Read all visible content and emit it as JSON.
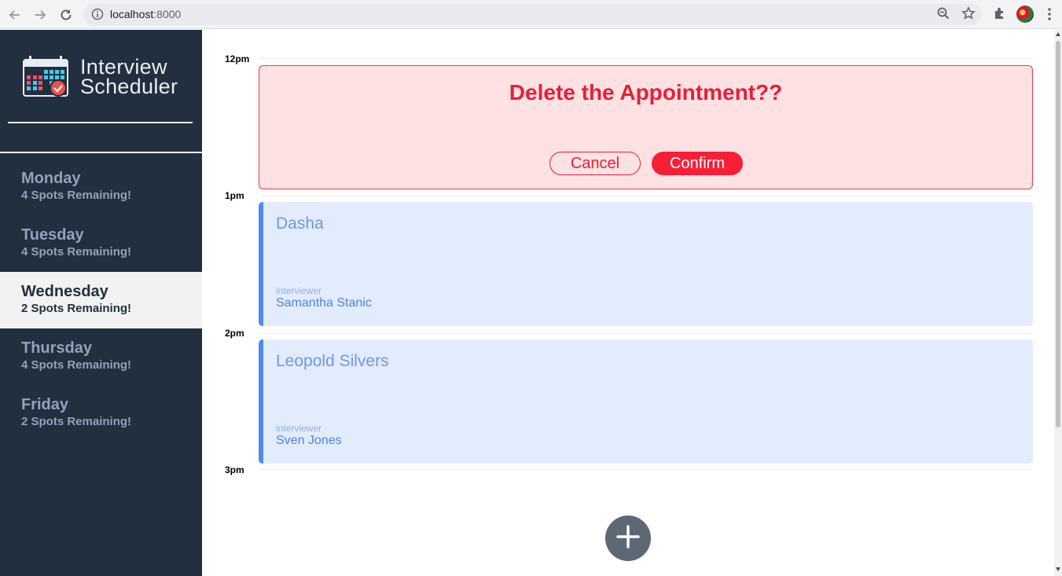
{
  "browser": {
    "url_host": "localhost",
    "url_port": ":8000",
    "icons": [
      "back-icon",
      "forward-icon",
      "reload-icon",
      "info-icon",
      "zoom-icon",
      "star-icon",
      "extensions-icon",
      "profile-avatar",
      "menu-icon"
    ]
  },
  "app": {
    "brand_line1": "Interview",
    "brand_line2": "Scheduler"
  },
  "sidebar": {
    "days": [
      {
        "name": "Monday",
        "spots": "4 Spots Remaining!",
        "selected": false
      },
      {
        "name": "Tuesday",
        "spots": "4 Spots Remaining!",
        "selected": false
      },
      {
        "name": "Wednesday",
        "spots": "2 Spots Remaining!",
        "selected": true
      },
      {
        "name": "Thursday",
        "spots": "4 Spots Remaining!",
        "selected": false
      },
      {
        "name": "Friday",
        "spots": "2 Spots Remaining!",
        "selected": false
      }
    ]
  },
  "schedule": {
    "times": [
      "12pm",
      "1pm",
      "2pm",
      "3pm"
    ],
    "confirm_dialog": {
      "message": "Delete the Appointment??",
      "cancel_label": "Cancel",
      "confirm_label": "Confirm"
    },
    "appointments": [
      {
        "student": "Dasha",
        "label": "interviewer",
        "interviewer": "Samantha Stanic"
      },
      {
        "student": "Leopold Silvers",
        "label": "interviewer",
        "interviewer": "Sven Jones"
      }
    ]
  },
  "colors": {
    "sidebar_bg": "#222f3e",
    "danger": "#f61f36",
    "appointment_accent": "#4f8af1",
    "add_button": "#5e6875"
  }
}
